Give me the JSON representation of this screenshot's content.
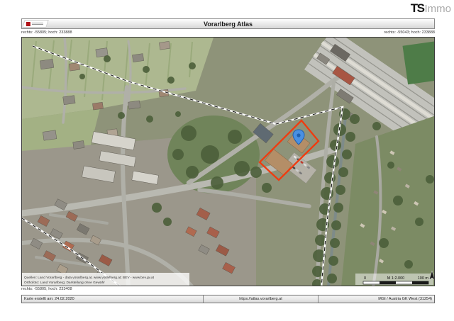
{
  "branding": {
    "bold": "TS",
    "light": "Immo"
  },
  "header": {
    "title": "Vorarlberg Atlas"
  },
  "coords": {
    "top_left": "rechts: -55805; hoch: 233888",
    "top_right": "rechts: -55043; hoch: 233888",
    "bottom_left": "rechts: -55805; hoch: 233408"
  },
  "map": {
    "attribution_line1": "Quellen: Land Vorarlberg - data.vorarlberg.at, www.vorarlberg.at; BEV - www.bev.gv.at",
    "attribution_line2": "Orthofoto: Land Vorarlberg; Darstellung ohne Gewähr",
    "scalebar": {
      "zero": "0",
      "scale": "M 1:2.000",
      "distance": "100 m"
    },
    "accent_colors": {
      "parcel_outline": "#f03b0f",
      "pin_fill": "#4a90e2"
    }
  },
  "footer": {
    "created": "Karte erstellt am: 24.02.2020",
    "url": "https://atlas.vorarlberg.at",
    "crs": "MGI / Austria GK West (31254)"
  }
}
